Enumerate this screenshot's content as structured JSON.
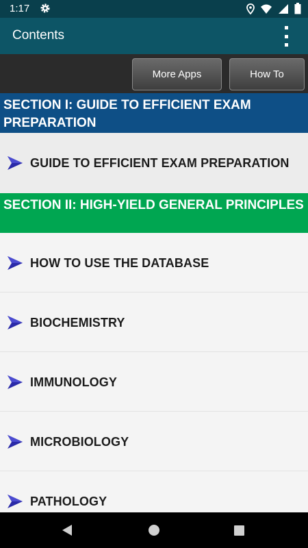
{
  "status_bar": {
    "time": "1:17"
  },
  "app_bar": {
    "title": "Contents"
  },
  "toolbar": {
    "more_apps_label": "More Apps",
    "how_to_label": "How To"
  },
  "sections": [
    {
      "title": "SECTION I: GUIDE TO EFFICIENT EXAM PREPARATION",
      "color": "#0e4f86",
      "items": [
        "GUIDE TO EFFICIENT EXAM PREPARATION"
      ]
    },
    {
      "title": "SECTION II: HIGH-YIELD GENERAL PRINCIPLES",
      "color": "#00a651",
      "items": [
        "HOW TO USE THE DATABASE",
        "BIOCHEMISTRY",
        "IMMUNOLOGY",
        "MICROBIOLOGY",
        "PATHOLOGY"
      ]
    }
  ],
  "colors": {
    "app_bar": "#0d5566",
    "status_bar": "#093f4c",
    "arrow": "#2a2aa8"
  },
  "icons": {
    "item_marker": "chevron-arrow-icon",
    "menu": "overflow-menu-icon"
  }
}
